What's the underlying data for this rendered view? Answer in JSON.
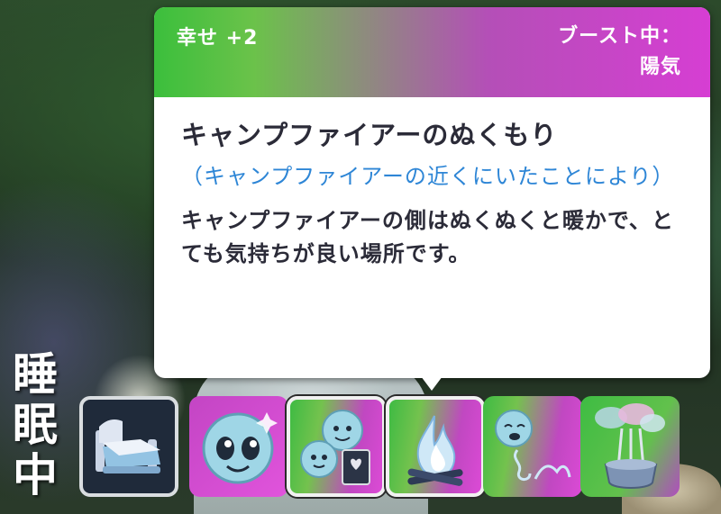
{
  "tooltip": {
    "mood": "幸せ +2",
    "boost_line1": "ブースト中：",
    "boost_line2": "陽気",
    "title": "キャンプファイアーのぬくもり",
    "source": "（キャンプファイアーの近くにいたことにより）",
    "description": "キャンプファイアーの側はぬくぬくと暖かで、とても気持ちが良い場所です。"
  },
  "status": {
    "label": "睡眠中"
  },
  "moodlets": [
    {
      "icon": "bed-icon",
      "selected": false
    },
    {
      "icon": "happy-face-icon",
      "selected": false
    },
    {
      "icon": "faces-book-icon",
      "selected": true
    },
    {
      "icon": "campfire-icon",
      "selected": true
    },
    {
      "icon": "bouncing-face-icon",
      "selected": false
    },
    {
      "icon": "incense-icon",
      "selected": false
    }
  ],
  "colors": {
    "happy_pink": "#d63ed3",
    "playful_green": "#3bbf3c",
    "source_blue": "#2e86d6"
  }
}
